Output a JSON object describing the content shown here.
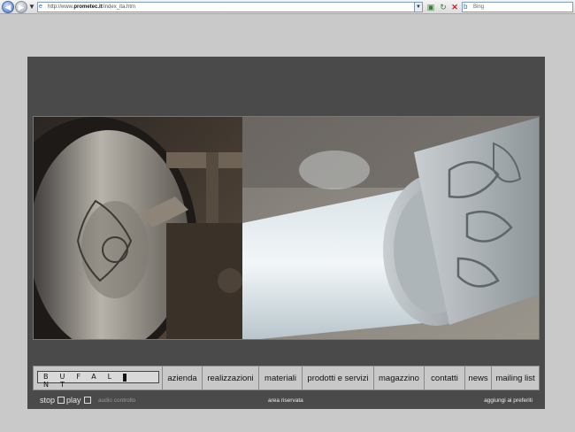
{
  "browser": {
    "url_prefix": "http://www.",
    "url_host": "prometec.it",
    "url_path": "/index_ita.htm",
    "search_placeholder": "Bing"
  },
  "site": {
    "logo_text": "BUFAL NT",
    "menu": [
      {
        "label": "azienda"
      },
      {
        "label": "realizzazioni"
      },
      {
        "label": "materiali"
      },
      {
        "label": "prodotti e servizi"
      },
      {
        "label": "magazzino"
      },
      {
        "label": "contatti"
      },
      {
        "label": "news"
      },
      {
        "label": "mailing list"
      }
    ],
    "footer": {
      "stop_label": "stop",
      "play_label": "play",
      "audio_label": "audio controllo",
      "area_label": "area riservata",
      "favorites_label": "aggiungi ai preferiti"
    }
  },
  "colors": {
    "page_bg": "#c9c9c9",
    "frame_bg": "#4a4a4a",
    "menu_bg": "#c8c8c8"
  }
}
